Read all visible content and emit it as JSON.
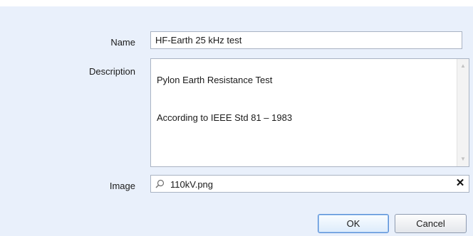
{
  "form": {
    "name_label": "Name",
    "name_value": "HF-Earth 25 kHz test",
    "description_label": "Description",
    "description_lines": [
      "Pylon Earth Resistance Test",
      "According to IEEE Std 81 – 1983"
    ],
    "image_label": "Image",
    "image_value": "110kV.png"
  },
  "icons": {
    "search": "search-icon",
    "clear": "close-icon",
    "scroll_up": "chevron-up-icon",
    "scroll_down": "chevron-down-icon"
  },
  "buttons": {
    "ok_label": "OK",
    "cancel_label": "Cancel"
  },
  "colors": {
    "panel_background": "#e9f0fb",
    "field_border": "#a9b3c3",
    "default_button_border": "#5a8fd6"
  }
}
